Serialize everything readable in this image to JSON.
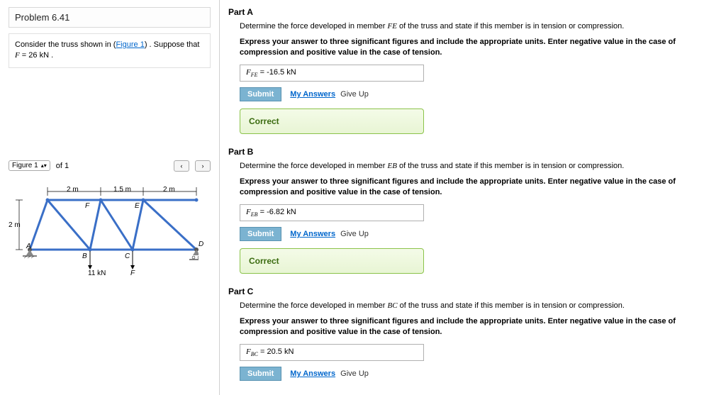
{
  "problem": {
    "title": "Problem 6.41",
    "description_pre": "Consider the truss shown in (",
    "figure_link": "Figure 1",
    "description_mid": ") . Suppose that ",
    "force_var": "F",
    "force_eq": " = 26 ",
    "force_unit": "kN",
    "description_post": " ."
  },
  "figure_nav": {
    "label": "Figure 1",
    "of_text": "of 1"
  },
  "truss": {
    "dim_2m": "2 m",
    "dim_1_5m": "1.5 m",
    "label_A": "A",
    "label_B": "B",
    "label_C": "C",
    "label_D": "D",
    "label_E": "E",
    "label_F": "F",
    "load_11kN": "11 kN",
    "load_F": "F"
  },
  "parts": [
    {
      "title": "Part A",
      "desc_pre": "Determine the force developed in member ",
      "member": "FE",
      "desc_post": " of the truss and state if this member is in tension or compression.",
      "hint": "Express your answer to three significant figures and include the appropriate units. Enter negative value in the case of compression and positive value in the case of tension.",
      "answer_var": "F",
      "answer_sub": "FE",
      "answer_eq": " =   ",
      "answer_val": "-16.5 kN",
      "submit": "Submit",
      "my_answers": "My Answers",
      "giveup": "Give Up",
      "correct": "Correct"
    },
    {
      "title": "Part B",
      "desc_pre": "Determine the force developed in member ",
      "member": "EB",
      "desc_post": " of the truss and state if this member is in tension or compression.",
      "hint": "Express your answer to three significant figures and include the appropriate units. Enter negative value in the case of compression and positive value in the case of tension.",
      "answer_var": "F",
      "answer_sub": "EB",
      "answer_eq": " =   ",
      "answer_val": "-6.82 kN",
      "submit": "Submit",
      "my_answers": "My Answers",
      "giveup": "Give Up",
      "correct": "Correct"
    },
    {
      "title": "Part C",
      "desc_pre": "Determine the force developed in member ",
      "member": "BC",
      "desc_post": " of the truss and state if this member is in tension or compression.",
      "hint": "Express your answer to three significant figures and include the appropriate units. Enter negative value in the case of compression and positive value in the case of tension.",
      "answer_var": "F",
      "answer_sub": "BC",
      "answer_eq": " =   ",
      "answer_val": "20.5 kN",
      "submit": "Submit",
      "my_answers": "My Answers",
      "giveup": "Give Up"
    }
  ]
}
